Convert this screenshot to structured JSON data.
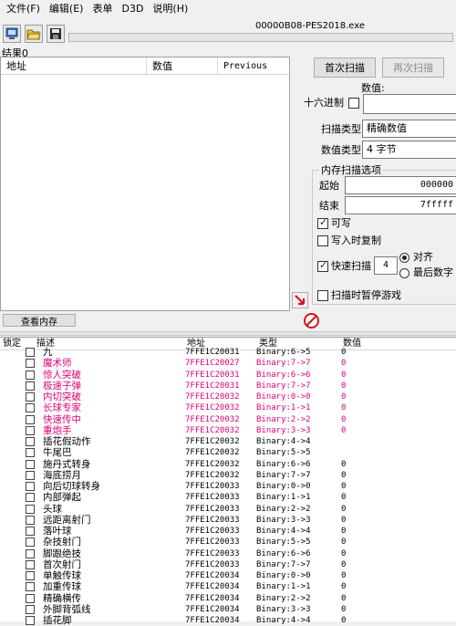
{
  "menubar": {
    "items": [
      "文件(F)",
      "编辑(E)",
      "表单",
      "D3D",
      "说明(H)"
    ]
  },
  "toolbar": {
    "process_title": "00000B08-PES2018.exe"
  },
  "results": {
    "label": "结果0",
    "columns": [
      "地址",
      "数值",
      "Previous"
    ]
  },
  "scan": {
    "first_scan": "首次扫描",
    "next_scan": "再次扫描",
    "value_label": "数值:",
    "hex_label": "十六进制",
    "scan_type_label": "扫描类型",
    "scan_type_value": "精确数值",
    "value_type_label": "数值类型",
    "value_type_value": "4 字节",
    "memory_options_label": "内存扫描选项",
    "start_label": "起始",
    "start_value": "000000",
    "end_label": "结束",
    "end_value": "7fffff",
    "writable_label": "可写",
    "copy_on_write_label": "写入时复制",
    "fast_scan_label": "快速扫描",
    "fast_scan_value": "4",
    "align_label": "对齐",
    "last_digits_label": "最后数字",
    "pause_label": "扫描时暂停游戏"
  },
  "view_memory_label": "查看内存",
  "address_list": {
    "columns": [
      "锁定",
      "描述",
      "地址",
      "类型",
      "数值"
    ],
    "rows": [
      {
        "desc": "九",
        "addr": "7FFE1C20031",
        "type": "Binary:6->5",
        "val": "0",
        "color": "#000000"
      },
      {
        "desc": "魔术师",
        "addr": "7FFE1C20027",
        "type": "Binary:7->7",
        "val": "0",
        "color": "#e0007a"
      },
      {
        "desc": "惊人突破",
        "addr": "7FFE1C20031",
        "type": "Binary:6->6",
        "val": "0",
        "color": "#e0007a"
      },
      {
        "desc": "极速子弹",
        "addr": "7FFE1C20031",
        "type": "Binary:7->7",
        "val": "0",
        "color": "#e0007a"
      },
      {
        "desc": "内切突破",
        "addr": "7FFE1C20032",
        "type": "Binary:0->0",
        "val": "0",
        "color": "#e0007a"
      },
      {
        "desc": "长球专家",
        "addr": "7FFE1C20032",
        "type": "Binary:1->1",
        "val": "0",
        "color": "#e0007a"
      },
      {
        "desc": "快速传中",
        "addr": "7FFE1C20032",
        "type": "Binary:2->2",
        "val": "0",
        "color": "#e0007a"
      },
      {
        "desc": "重炮手",
        "addr": "7FFE1C20032",
        "type": "Binary:3->3",
        "val": "0",
        "color": "#e0007a"
      },
      {
        "desc": "插花假动作",
        "addr": "7FFE1C20032",
        "type": "Binary:4->4",
        "val": "",
        "color": "#000000"
      },
      {
        "desc": "牛尾巴",
        "addr": "7FFE1C20032",
        "type": "Binary:5->5",
        "val": "",
        "color": "#000000"
      },
      {
        "desc": "施丹式转身",
        "addr": "7FFE1C20032",
        "type": "Binary:6->6",
        "val": "0",
        "color": "#000000"
      },
      {
        "desc": "海底捞月",
        "addr": "7FFE1C20032",
        "type": "Binary:7->7",
        "val": "0",
        "color": "#000000"
      },
      {
        "desc": "向后切球转身",
        "addr": "7FFE1C20033",
        "type": "Binary:0->0",
        "val": "0",
        "color": "#000000"
      },
      {
        "desc": "内部弹起",
        "addr": "7FFE1C20033",
        "type": "Binary:1->1",
        "val": "0",
        "color": "#000000"
      },
      {
        "desc": "头球",
        "addr": "7FFE1C20033",
        "type": "Binary:2->2",
        "val": "0",
        "color": "#000000"
      },
      {
        "desc": "远距离射门",
        "addr": "7FFE1C20033",
        "type": "Binary:3->3",
        "val": "0",
        "color": "#000000"
      },
      {
        "desc": "落叶球",
        "addr": "7FFE1C20033",
        "type": "Binary:4->4",
        "val": "0",
        "color": "#000000"
      },
      {
        "desc": "杂技射门",
        "addr": "7FFE1C20033",
        "type": "Binary:5->5",
        "val": "0",
        "color": "#000000"
      },
      {
        "desc": "脚跟绝技",
        "addr": "7FFE1C20033",
        "type": "Binary:6->6",
        "val": "0",
        "color": "#000000"
      },
      {
        "desc": "首次射门",
        "addr": "7FFE1C20033",
        "type": "Binary:7->7",
        "val": "0",
        "color": "#000000"
      },
      {
        "desc": "单触传球",
        "addr": "7FFE1C20034",
        "type": "Binary:0->0",
        "val": "0",
        "color": "#000000"
      },
      {
        "desc": "加重传球",
        "addr": "7FFE1C20034",
        "type": "Binary:1->1",
        "val": "0",
        "color": "#000000"
      },
      {
        "desc": "精确横传",
        "addr": "7FFE1C20034",
        "type": "Binary:2->2",
        "val": "0",
        "color": "#000000"
      },
      {
        "desc": "外脚背弧线",
        "addr": "7FFE1C20034",
        "type": "Binary:3->3",
        "val": "0",
        "color": "#000000"
      },
      {
        "desc": "插花脚",
        "addr": "7FFE1C20034",
        "type": "Binary:4->4",
        "val": "0",
        "color": "#000000"
      }
    ]
  }
}
